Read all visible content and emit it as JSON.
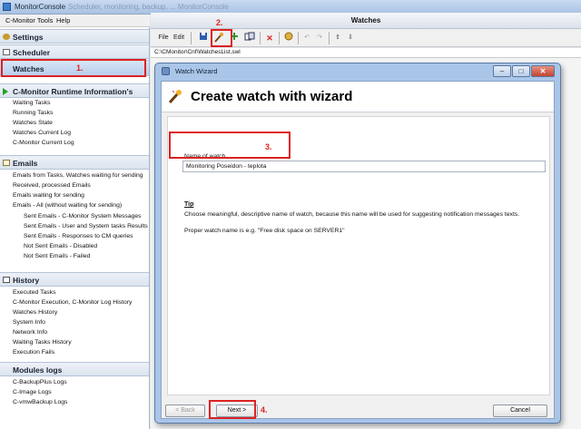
{
  "app": {
    "title": "MonitorConsole",
    "title_tail": "- Scheduler, monitoring, backup, ... MonitorConsole"
  },
  "menu": [
    "C-Monitor Tools",
    "Help"
  ],
  "sidebar": {
    "settings": "Settings",
    "scheduler": "Scheduler",
    "watches": "Watches",
    "runtime": {
      "title": "C-Monitor Runtime Information's",
      "items": [
        "Waiting Tasks",
        "Running Tasks",
        "Watches State",
        "Watches Current Log",
        "C-Monitor Current Log"
      ]
    },
    "emails": {
      "title": "Emails",
      "items": [
        "Emails from Tasks, Watches waiting for sending",
        "Received, processed Emails",
        "Emails waiting for sending",
        "Emails - All (without waiting for sending)"
      ],
      "sub_items": [
        "Sent Emails - C-Monitor System Messages",
        "Sent Emails - User and System tasks Results",
        "Sent Emails - Responses to CM queries",
        "Not Sent Emails - Disabled",
        "Not Sent Emails - Failed"
      ]
    },
    "history": {
      "title": "History",
      "items": [
        "Executed Tasks",
        "C-Monitor Execution, C-Monitor Log History",
        "Watches History",
        "System Info",
        "Network Info",
        "Waiting Tasks History",
        "Execution Fails"
      ]
    },
    "modules": {
      "title": "Modules logs",
      "items": [
        "C-BackupPlus Logs",
        "C-Image Logs",
        "C-vmwBackup Logs"
      ]
    }
  },
  "right": {
    "title": "Watches",
    "toolbar": {
      "file": "File",
      "edit": "Edit"
    },
    "path": "C:\\CMonitor\\Cnf\\WatchesList.swl"
  },
  "dialog": {
    "title": "Watch Wizard",
    "heading": "Create watch with wizard",
    "field_label": "Name of watch",
    "field_value": "Monitoring Poseidon - teplota",
    "tip_title": "Tip",
    "tip_text": "Choose meaningful, descriptive name of watch, because this name will be used for suggesting notification messages texts.",
    "tip_example": "Proper watch name is e.g. \"Free disk space on SERVER1\"",
    "back": "< Back",
    "next": "Next >",
    "cancel": "Cancel"
  },
  "annotations": [
    "1.",
    "2.",
    "3.",
    "4."
  ],
  "colors": {
    "annotation": "#dd2222",
    "dialog_frame": "#a9c5e8",
    "sidebar_header": "#dbe4ef"
  }
}
